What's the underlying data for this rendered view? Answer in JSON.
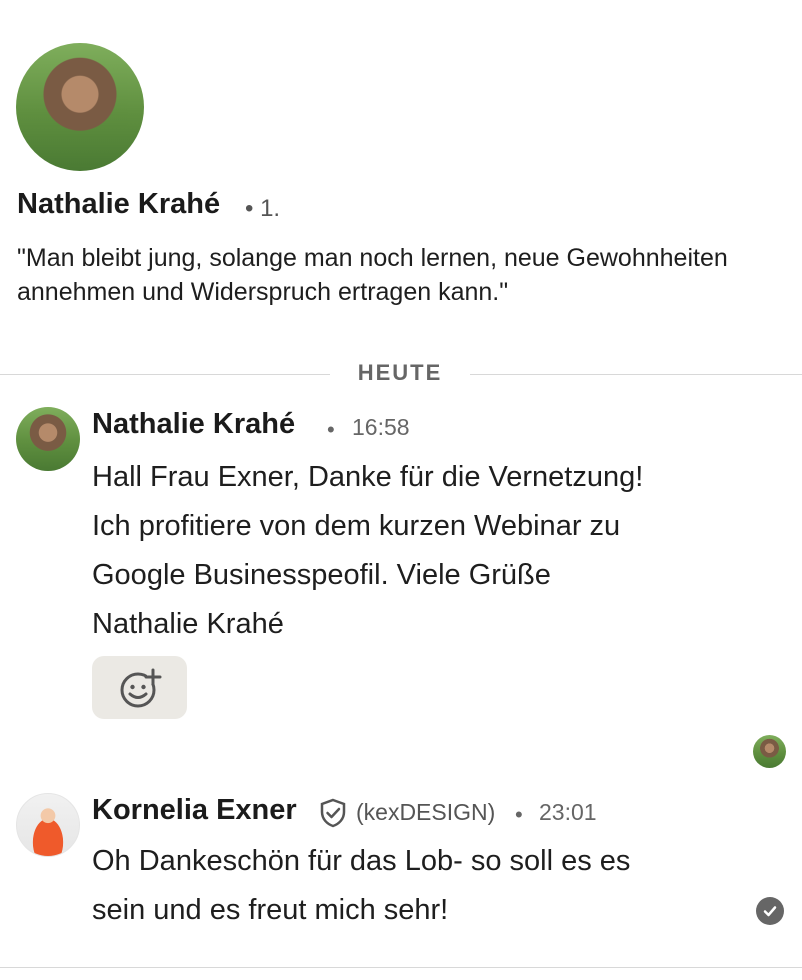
{
  "profile": {
    "name": "Nathalie Krahé",
    "degree": "• 1.",
    "quote": "\"Man bleibt jung, solange man noch lernen, neue Gewohnheiten annehmen und Widerspruch ertragen kann.\""
  },
  "divider": {
    "label": "HEUTE"
  },
  "messages": [
    {
      "sender": "Nathalie Krahé",
      "separator": "•",
      "time": "16:58",
      "lines": [
        "Hall Frau Exner, Danke für die Vernetzung!",
        "Ich profitiere von dem kurzen Webinar zu",
        "Google Businesspeofil. Viele Grüße",
        "Nathalie Krahé"
      ],
      "reaction_icon": "add-reaction-icon"
    },
    {
      "sender": "Kornelia Exner",
      "verified_icon": "verified-shield-icon",
      "company": "(kexDESIGN)",
      "separator": "•",
      "time": "23:01",
      "lines": [
        "Oh Dankeschön für das Lob- so soll es es",
        "sein und es freut mich sehr!"
      ],
      "status_icon": "read-check-icon"
    }
  ],
  "colors": {
    "reaction_bg": "#ebe9e4",
    "muted_text": "#666666",
    "divider": "#d8d8d8"
  }
}
